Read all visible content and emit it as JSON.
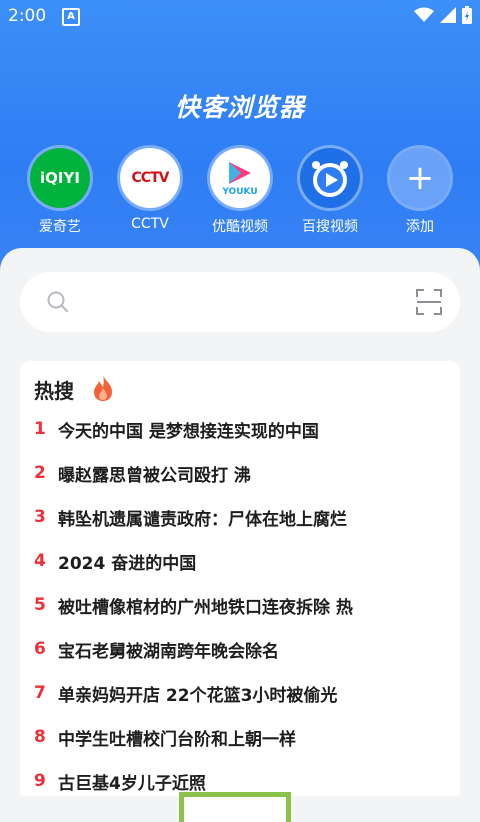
{
  "status": {
    "time": "2:00",
    "notif": "A"
  },
  "app": {
    "title": "快客浏览器"
  },
  "shortcuts": [
    {
      "label": "爱奇艺",
      "logo_text": "iQIYI",
      "icon": "iqiyi-icon",
      "color": "#00b33c"
    },
    {
      "label": "CCTV",
      "logo_text": "CCTV",
      "icon": "cctv-icon",
      "color": "#ffffff"
    },
    {
      "label": "优酷视频",
      "logo_text": "YOUKU",
      "icon": "youku-icon",
      "color": "#ffffff"
    },
    {
      "label": "百搜视频",
      "logo_text": "",
      "icon": "baisou-icon",
      "color": "#2f7df4"
    },
    {
      "label": "添加",
      "logo_text": "+",
      "icon": "add-icon",
      "color": "#7fb4f8"
    }
  ],
  "hot": {
    "title": "热搜",
    "items": [
      {
        "num": "1",
        "text": "今天的中国 是梦想接连实现的中国"
      },
      {
        "num": "2",
        "text": "曝赵露思曾被公司殴打  沸"
      },
      {
        "num": "3",
        "text": "韩坠机遗属谴责政府：尸体在地上腐烂"
      },
      {
        "num": "4",
        "text": "2024 奋进的中国"
      },
      {
        "num": "5",
        "text": "被吐槽像棺材的广州地铁口连夜拆除  热"
      },
      {
        "num": "6",
        "text": "宝石老舅被湖南跨年晚会除名"
      },
      {
        "num": "7",
        "text": "单亲妈妈开店 22个花篮3小时被偷光"
      },
      {
        "num": "8",
        "text": "中学生吐槽校门台阶和上朝一样"
      },
      {
        "num": "9",
        "text": "古巨基4岁儿子近照"
      }
    ]
  },
  "colors": {
    "accent": "#2f7df4",
    "hot_number": "#ee2f3a"
  }
}
